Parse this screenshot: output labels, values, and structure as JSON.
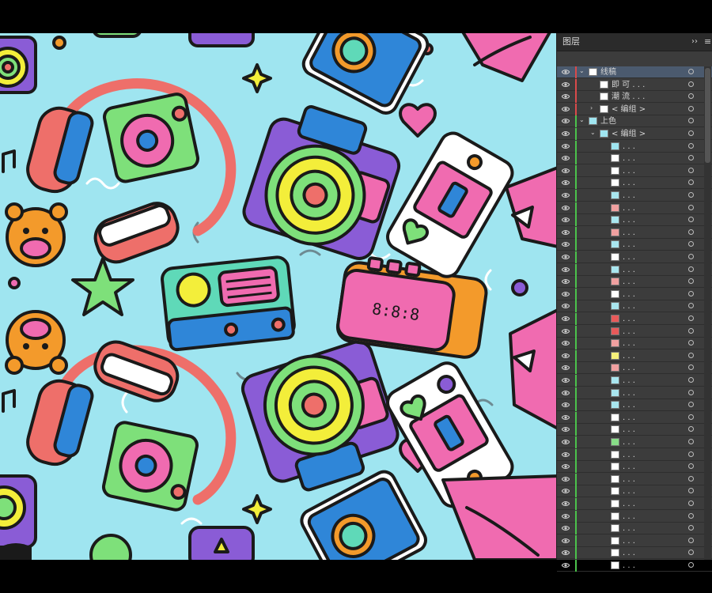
{
  "panel": {
    "title": "图层",
    "collapse_icon": "double-chevron-right-icon",
    "menu_icon": "hamburger-menu-icon"
  },
  "layers": [
    {
      "name": "线稿",
      "depth": 0,
      "expanded": true,
      "selected": true,
      "color": "#d94a4a",
      "thumb": "#ffffff"
    },
    {
      "name": "即 可 . . .",
      "depth": 1,
      "color": "#d94a4a",
      "thumb": "#ffffff"
    },
    {
      "name": "潮 流 . . .",
      "depth": 1,
      "color": "#d94a4a",
      "thumb": "#ffffff"
    },
    {
      "name": "< 编组 >",
      "depth": 1,
      "expanded": false,
      "color": "#d94a4a",
      "thumb": "#ffffff"
    },
    {
      "name": "上色",
      "depth": 0,
      "expanded": true,
      "color": "#4bc24b",
      "thumb": "#9fe5f0"
    },
    {
      "name": "< 编组 >",
      "depth": 1,
      "expanded": true,
      "color": "#4bc24b",
      "thumb": "#9fe5f0"
    },
    {
      "name": ". . .",
      "depth": 2,
      "color": "#4bc24b",
      "thumb": "#9fe5f0"
    },
    {
      "name": ". . .",
      "depth": 2,
      "color": "#4bc24b",
      "thumb": "#ffffff"
    },
    {
      "name": ". . .",
      "depth": 2,
      "color": "#4bc24b",
      "thumb": "#ffffff"
    },
    {
      "name": ". . .",
      "depth": 2,
      "color": "#4bc24b",
      "thumb": "#ffffff"
    },
    {
      "name": ". . .",
      "depth": 2,
      "color": "#4bc24b",
      "thumb": "#a9e6ef"
    },
    {
      "name": ". . .",
      "depth": 2,
      "color": "#4bc24b",
      "thumb": "#f0a0a0"
    },
    {
      "name": ". . .",
      "depth": 2,
      "color": "#4bc24b",
      "thumb": "#a9e6ef"
    },
    {
      "name": ". . .",
      "depth": 2,
      "color": "#4bc24b",
      "thumb": "#f0a0a0"
    },
    {
      "name": ". . .",
      "depth": 2,
      "color": "#4bc24b",
      "thumb": "#a9e6ef"
    },
    {
      "name": ". . .",
      "depth": 2,
      "color": "#4bc24b",
      "thumb": "#ffffff"
    },
    {
      "name": ". . .",
      "depth": 2,
      "color": "#4bc24b",
      "thumb": "#a9e6ef"
    },
    {
      "name": ". . .",
      "depth": 2,
      "color": "#4bc24b",
      "thumb": "#f0a0a0"
    },
    {
      "name": ". . .",
      "depth": 2,
      "color": "#4bc24b",
      "thumb": "#ffffff"
    },
    {
      "name": ". . .",
      "depth": 2,
      "color": "#4bc24b",
      "thumb": "#a9e6ef"
    },
    {
      "name": ". . .",
      "depth": 2,
      "color": "#4bc24b",
      "thumb": "#e85a5a"
    },
    {
      "name": ". . .",
      "depth": 2,
      "color": "#4bc24b",
      "thumb": "#e85a5a"
    },
    {
      "name": ". . .",
      "depth": 2,
      "color": "#4bc24b",
      "thumb": "#f0a0a0"
    },
    {
      "name": ". . .",
      "depth": 2,
      "color": "#4bc24b",
      "thumb": "#f5f07a"
    },
    {
      "name": ". . .",
      "depth": 2,
      "color": "#4bc24b",
      "thumb": "#f0a0a0"
    },
    {
      "name": ". . .",
      "depth": 2,
      "color": "#4bc24b",
      "thumb": "#a9e6ef"
    },
    {
      "name": ". . .",
      "depth": 2,
      "color": "#4bc24b",
      "thumb": "#a9e6ef"
    },
    {
      "name": ". . .",
      "depth": 2,
      "color": "#4bc24b",
      "thumb": "#a9e6ef"
    },
    {
      "name": ". . .",
      "depth": 2,
      "color": "#4bc24b",
      "thumb": "#ffffff"
    },
    {
      "name": ". . .",
      "depth": 2,
      "color": "#4bc24b",
      "thumb": "#ffffff"
    },
    {
      "name": ". . .",
      "depth": 2,
      "color": "#4bc24b",
      "thumb": "#88dd88"
    },
    {
      "name": ". . .",
      "depth": 2,
      "color": "#4bc24b",
      "thumb": "#ffffff"
    },
    {
      "name": ". . .",
      "depth": 2,
      "color": "#4bc24b",
      "thumb": "#ffffff"
    },
    {
      "name": ". . .",
      "depth": 2,
      "color": "#4bc24b",
      "thumb": "#ffffff"
    },
    {
      "name": ". . .",
      "depth": 2,
      "color": "#4bc24b",
      "thumb": "#ffffff"
    },
    {
      "name": ". . .",
      "depth": 2,
      "color": "#4bc24b",
      "thumb": "#ffffff"
    },
    {
      "name": ". . .",
      "depth": 2,
      "color": "#4bc24b",
      "thumb": "#ffffff"
    },
    {
      "name": ". . .",
      "depth": 2,
      "color": "#4bc24b",
      "thumb": "#ffffff"
    },
    {
      "name": ". . .",
      "depth": 2,
      "color": "#4bc24b",
      "thumb": "#ffffff"
    },
    {
      "name": ". . .",
      "depth": 2,
      "color": "#4bc24b",
      "thumb": "#ffffff"
    },
    {
      "name": ". . .",
      "depth": 2,
      "color": "#4bc24b",
      "thumb": "#ffffff"
    }
  ],
  "artwork": {
    "background": "#9fe5f0",
    "outline": "#1a1a1a",
    "colors": {
      "pink": "#f06bb0",
      "red": "#ee6f6a",
      "green": "#7ee07a",
      "yellow": "#f3ee3a",
      "blue": "#2f86d8",
      "purple": "#8a5cd6",
      "orange": "#f39a2b",
      "teal": "#5fd9b8",
      "white": "#ffffff"
    },
    "radio_dial_icon": "radio-icon",
    "clock_display": "8:8:8"
  }
}
